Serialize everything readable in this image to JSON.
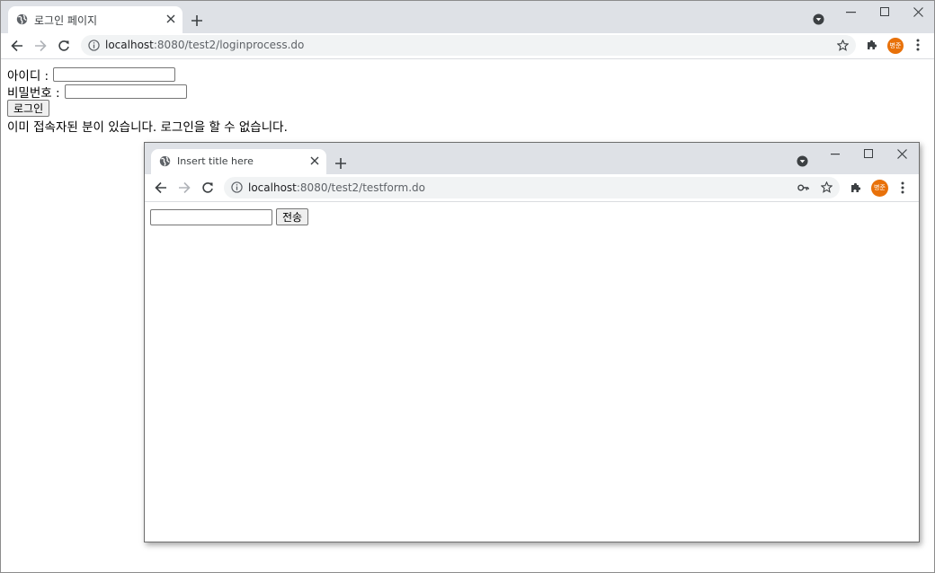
{
  "main_window": {
    "tab_title": "로그인 페이지",
    "url_host": "localhost",
    "url_path": ":8080/test2/loginprocess.do",
    "profile_initials": "병준",
    "page": {
      "id_label": "아이디 :",
      "id_value": "",
      "password_label": "비밀번호 :",
      "password_value": "",
      "login_button": "로그인",
      "message": "이미 접속자된 분이 있습니다. 로그인을 할 수 없습니다."
    }
  },
  "popup_window": {
    "tab_title": "Insert title here",
    "url_host": "localhost",
    "url_path": ":8080/test2/testform.do",
    "profile_initials": "병준",
    "page": {
      "input_value": "",
      "submit_button": "전송"
    }
  },
  "colors": {
    "tabstrip": "#dee1e6",
    "omnibox": "#f1f3f4",
    "avatar": "#e8710a"
  }
}
